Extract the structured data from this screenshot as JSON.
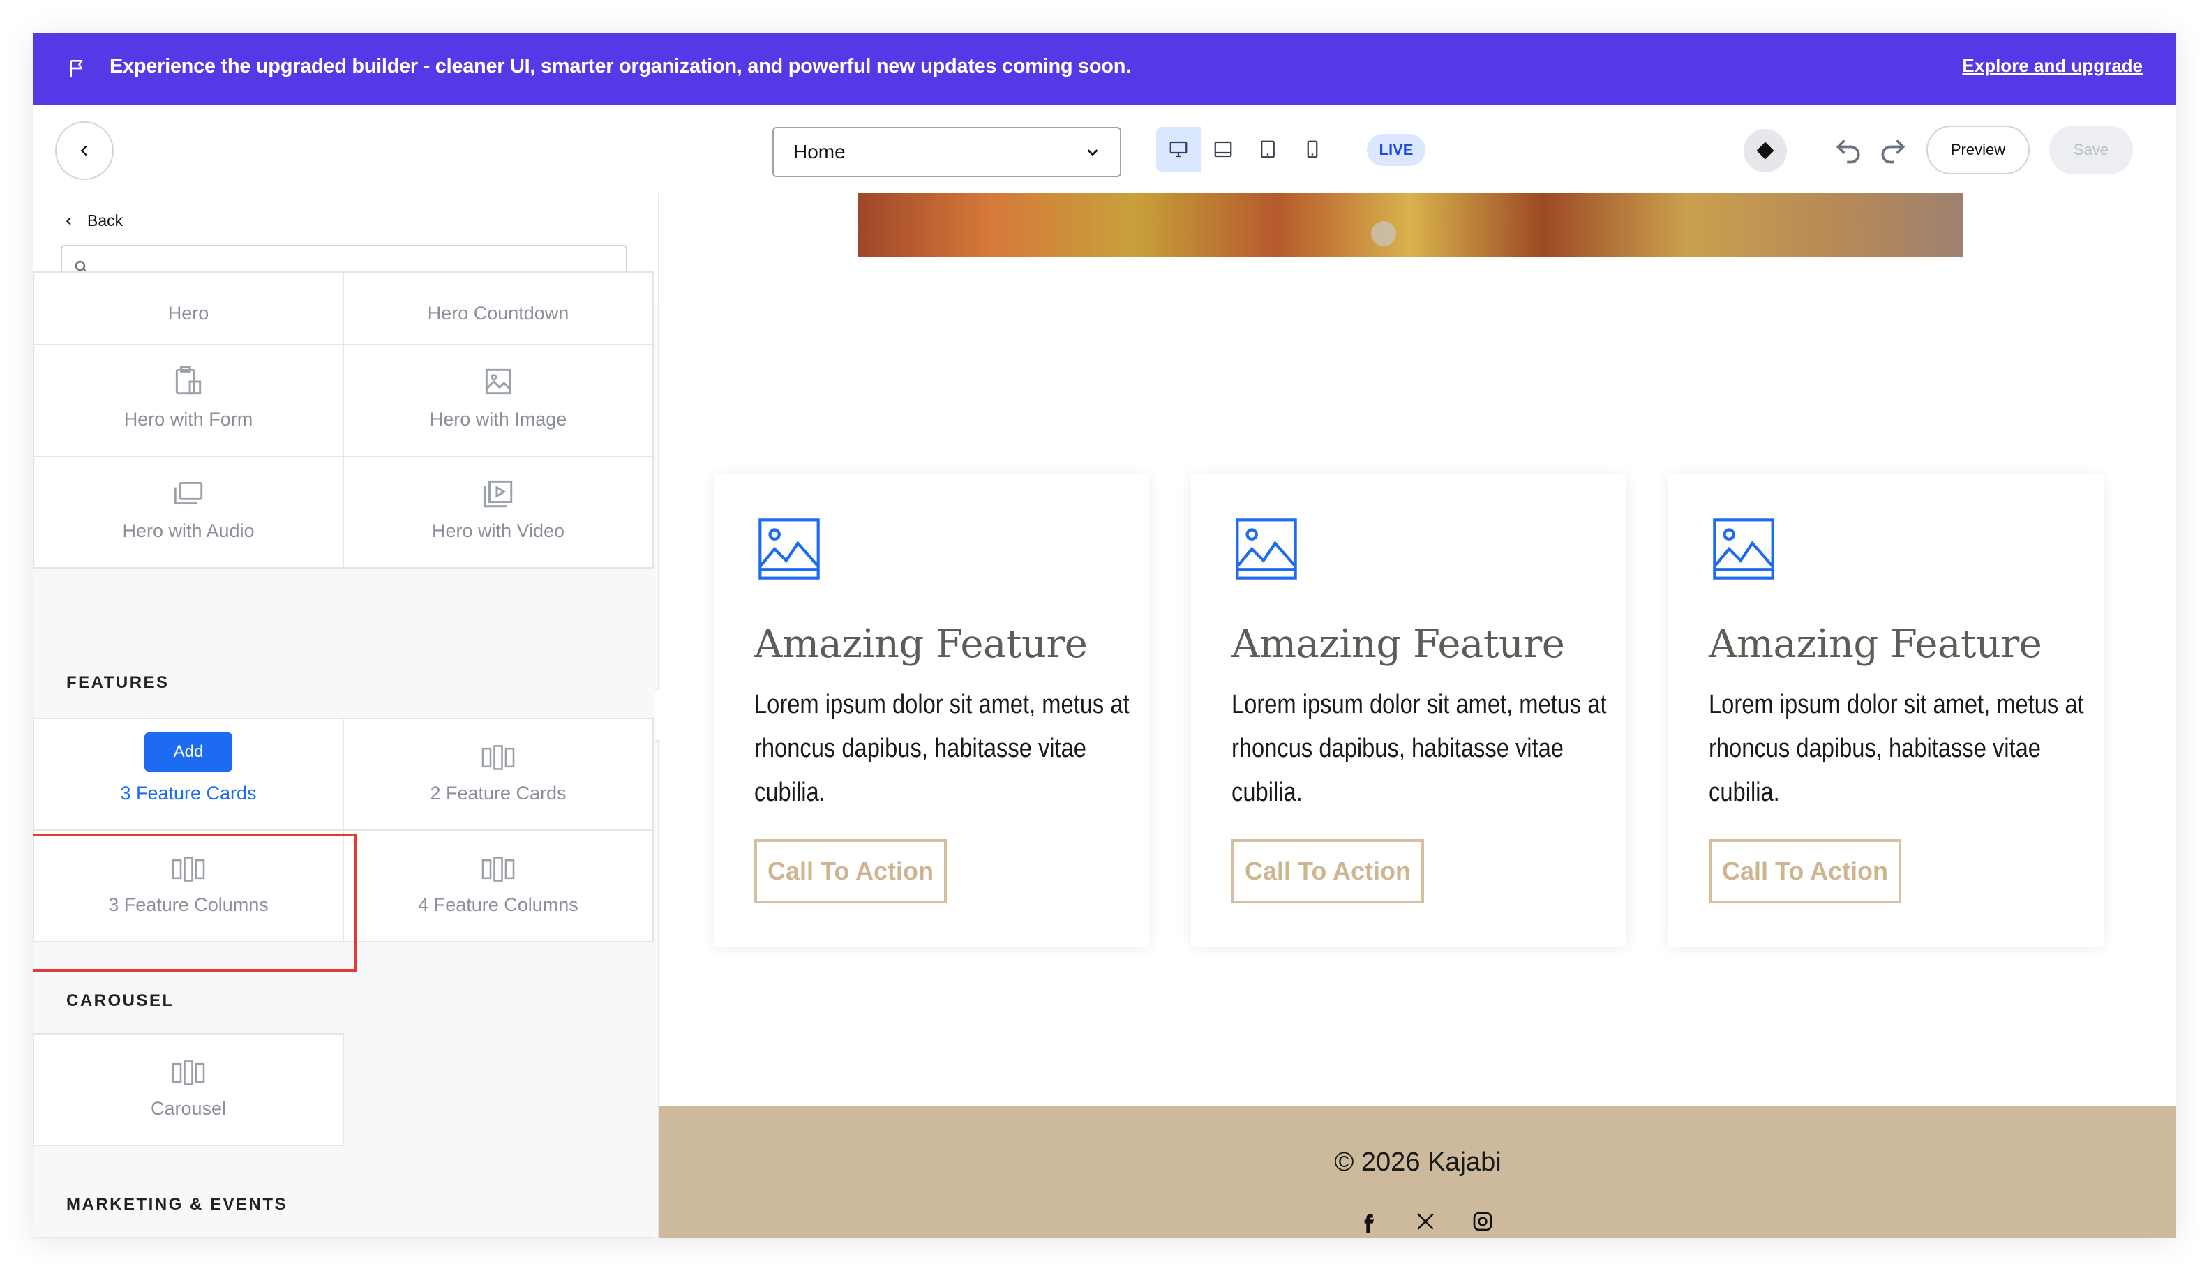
{
  "banner": {
    "message": "Experience the upgraded builder - cleaner UI, smarter organization, and powerful new updates coming soon.",
    "link_label": "Explore and upgrade",
    "bg_color": "#5538e6"
  },
  "toolbar": {
    "page_select_value": "Home",
    "status_badge": "LIVE",
    "preview_label": "Preview",
    "save_label": "Save"
  },
  "sidebar": {
    "back_label": "Back",
    "search_value": "",
    "hero_tiles": [
      {
        "label": "Hero",
        "icon": "hero-icon"
      },
      {
        "label": "Hero Countdown",
        "icon": "countdown-icon"
      },
      {
        "label": "Hero with Form",
        "icon": "form-icon"
      },
      {
        "label": "Hero with Image",
        "icon": "image-icon"
      },
      {
        "label": "Hero with Audio",
        "icon": "audio-icon"
      },
      {
        "label": "Hero with Video",
        "icon": "video-icon"
      }
    ],
    "features_title": "FEATURES",
    "feature_tiles": [
      {
        "label": "3 Feature Cards",
        "icon": "columns-icon",
        "add_label": "Add"
      },
      {
        "label": "2 Feature Cards",
        "icon": "columns-icon"
      },
      {
        "label": "3 Feature Columns",
        "icon": "columns-icon"
      },
      {
        "label": "4 Feature Columns",
        "icon": "columns-icon"
      }
    ],
    "carousel_title": "CAROUSEL",
    "carousel_tiles": [
      {
        "label": "Carousel",
        "icon": "columns-icon"
      }
    ],
    "marketing_title": "MARKETING & EVENTS"
  },
  "canvas": {
    "cards": [
      {
        "title": "Amazing Feature",
        "body": "Lorem ipsum dolor sit amet, metus at rhoncus dapibus, habitasse vitae cubilia.",
        "cta": "Call To Action"
      },
      {
        "title": "Amazing Feature",
        "body": "Lorem ipsum dolor sit amet, metus at rhoncus dapibus, habitasse vitae cubilia.",
        "cta": "Call To Action"
      },
      {
        "title": "Amazing Feature",
        "body": "Lorem ipsum dolor sit amet, metus at rhoncus dapibus, habitasse vitae cubilia.",
        "cta": "Call To Action"
      }
    ],
    "footer_copyright": "© 2026 Kajabi",
    "footer_bg": "#cdb99b",
    "accent": "#1d6bf0"
  }
}
